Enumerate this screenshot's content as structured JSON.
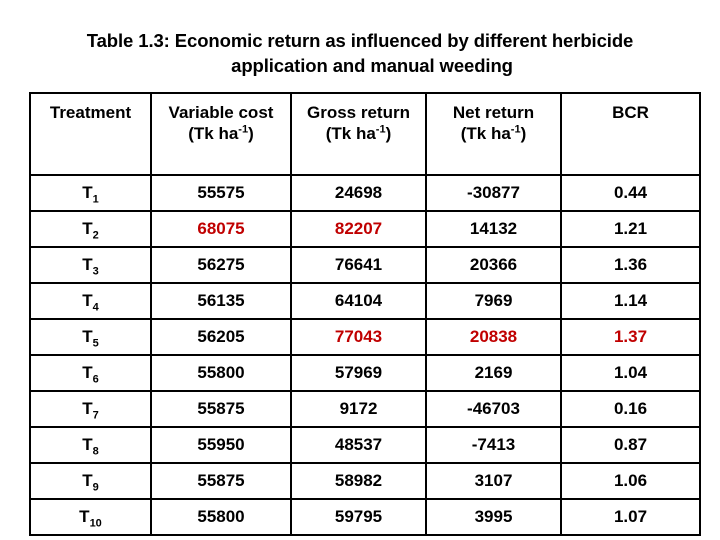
{
  "title": {
    "line1": "Table 1.3: Economic return as influenced by different herbicide",
    "line2": "application and manual  weeding"
  },
  "accent_color": "#C00000",
  "table": {
    "headers": [
      {
        "label": "Treatment",
        "unit": ""
      },
      {
        "label": "Variable cost",
        "unit_prefix": "(Tk ha",
        "unit_sup": "-1",
        "unit_suffix": ")"
      },
      {
        "label": "Gross return",
        "unit_prefix": "(Tk ha",
        "unit_sup": "-1",
        "unit_suffix": ")"
      },
      {
        "label": "Net return",
        "unit_prefix": "(Tk ha",
        "unit_sup": "-1",
        "unit_suffix": ")"
      },
      {
        "label": "BCR",
        "unit": ""
      }
    ],
    "rows": [
      {
        "treatment_base": "T",
        "treatment_sub": "1",
        "variable_cost": "55575",
        "variable_cost_hl": false,
        "gross_return": "24698",
        "gross_return_hl": false,
        "net_return": "-30877",
        "net_return_hl": false,
        "bcr": "0.44",
        "bcr_hl": false
      },
      {
        "treatment_base": "T",
        "treatment_sub": "2",
        "variable_cost": "68075",
        "variable_cost_hl": true,
        "gross_return": "82207",
        "gross_return_hl": true,
        "net_return": "14132",
        "net_return_hl": false,
        "bcr": "1.21",
        "bcr_hl": false
      },
      {
        "treatment_base": "T",
        "treatment_sub": "3",
        "variable_cost": "56275",
        "variable_cost_hl": false,
        "gross_return": "76641",
        "gross_return_hl": false,
        "net_return": "20366",
        "net_return_hl": false,
        "bcr": "1.36",
        "bcr_hl": false
      },
      {
        "treatment_base": "T",
        "treatment_sub": "4",
        "variable_cost": "56135",
        "variable_cost_hl": false,
        "gross_return": "64104",
        "gross_return_hl": false,
        "net_return": "7969",
        "net_return_hl": false,
        "bcr": "1.14",
        "bcr_hl": false
      },
      {
        "treatment_base": "T",
        "treatment_sub": "5",
        "variable_cost": "56205",
        "variable_cost_hl": false,
        "gross_return": "77043",
        "gross_return_hl": true,
        "net_return": "20838",
        "net_return_hl": true,
        "bcr": "1.37",
        "bcr_hl": true
      },
      {
        "treatment_base": "T",
        "treatment_sub": "6",
        "variable_cost": "55800",
        "variable_cost_hl": false,
        "gross_return": "57969",
        "gross_return_hl": false,
        "net_return": "2169",
        "net_return_hl": false,
        "bcr": "1.04",
        "bcr_hl": false
      },
      {
        "treatment_base": "T",
        "treatment_sub": "7",
        "variable_cost": "55875",
        "variable_cost_hl": false,
        "gross_return": "9172",
        "gross_return_hl": false,
        "net_return": "-46703",
        "net_return_hl": false,
        "bcr": "0.16",
        "bcr_hl": false
      },
      {
        "treatment_base": "T",
        "treatment_sub": "8",
        "variable_cost": "55950",
        "variable_cost_hl": false,
        "gross_return": "48537",
        "gross_return_hl": false,
        "net_return": "-7413",
        "net_return_hl": false,
        "bcr": "0.87",
        "bcr_hl": false
      },
      {
        "treatment_base": "T",
        "treatment_sub": "9",
        "variable_cost": "55875",
        "variable_cost_hl": false,
        "gross_return": "58982",
        "gross_return_hl": false,
        "net_return": "3107",
        "net_return_hl": false,
        "bcr": "1.06",
        "bcr_hl": false
      },
      {
        "treatment_base": "T",
        "treatment_sub": "10",
        "variable_cost": "55800",
        "variable_cost_hl": false,
        "gross_return": "59795",
        "gross_return_hl": false,
        "net_return": "3995",
        "net_return_hl": false,
        "bcr": "1.07",
        "bcr_hl": false
      }
    ]
  },
  "chart_data": {
    "type": "table",
    "title": "Table 1.3: Economic return as influenced by different herbicide application and manual  weeding",
    "columns": [
      "Treatment",
      "Variable cost (Tk ha-1)",
      "Gross return (Tk ha-1)",
      "Net return (Tk ha-1)",
      "BCR"
    ],
    "rows": [
      [
        "T1",
        55575,
        24698,
        -30877,
        0.44
      ],
      [
        "T2",
        68075,
        82207,
        14132,
        1.21
      ],
      [
        "T3",
        56275,
        76641,
        20366,
        1.36
      ],
      [
        "T4",
        56135,
        64104,
        7969,
        1.14
      ],
      [
        "T5",
        56205,
        77043,
        20838,
        1.37
      ],
      [
        "T6",
        55800,
        57969,
        2169,
        1.04
      ],
      [
        "T7",
        55875,
        9172,
        -46703,
        0.16
      ],
      [
        "T8",
        55950,
        48537,
        -7413,
        0.87
      ],
      [
        "T9",
        55875,
        58982,
        3107,
        1.06
      ],
      [
        "T10",
        55800,
        59795,
        3995,
        1.07
      ]
    ],
    "highlighted_cells": [
      {
        "row": "T2",
        "column": "Variable cost (Tk ha-1)",
        "value": 68075
      },
      {
        "row": "T2",
        "column": "Gross return (Tk ha-1)",
        "value": 82207
      },
      {
        "row": "T5",
        "column": "Gross return (Tk ha-1)",
        "value": 77043
      },
      {
        "row": "T5",
        "column": "Net return (Tk ha-1)",
        "value": 20838
      },
      {
        "row": "T5",
        "column": "BCR",
        "value": 1.37
      }
    ],
    "highlight_color": "#C00000"
  }
}
